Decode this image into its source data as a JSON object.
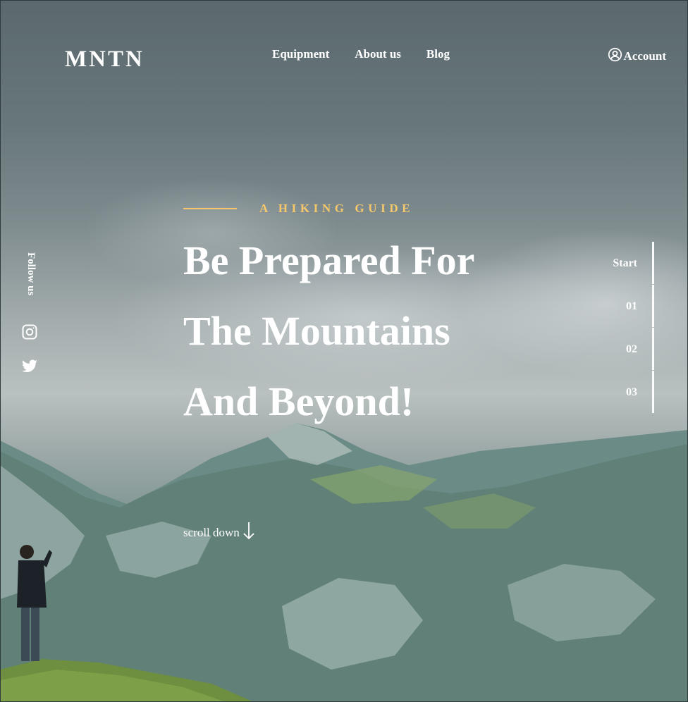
{
  "brand": {
    "logo": "MNTN"
  },
  "nav": {
    "items": [
      {
        "label": "Equipment"
      },
      {
        "label": "About us"
      },
      {
        "label": "Blog"
      }
    ],
    "account_label": "Account"
  },
  "hero": {
    "tagline": "A HIKING GUIDE",
    "headline": "Be Prepared For The Mountains And Beyond!",
    "scroll_label": "scroll down"
  },
  "social": {
    "follow_label": "Follow us",
    "icons": [
      "instagram-icon",
      "twitter-icon"
    ]
  },
  "steps": [
    "Start",
    "01",
    "02",
    "03"
  ],
  "colors": {
    "accent": "#f5c86b",
    "text": "#ffffff"
  }
}
